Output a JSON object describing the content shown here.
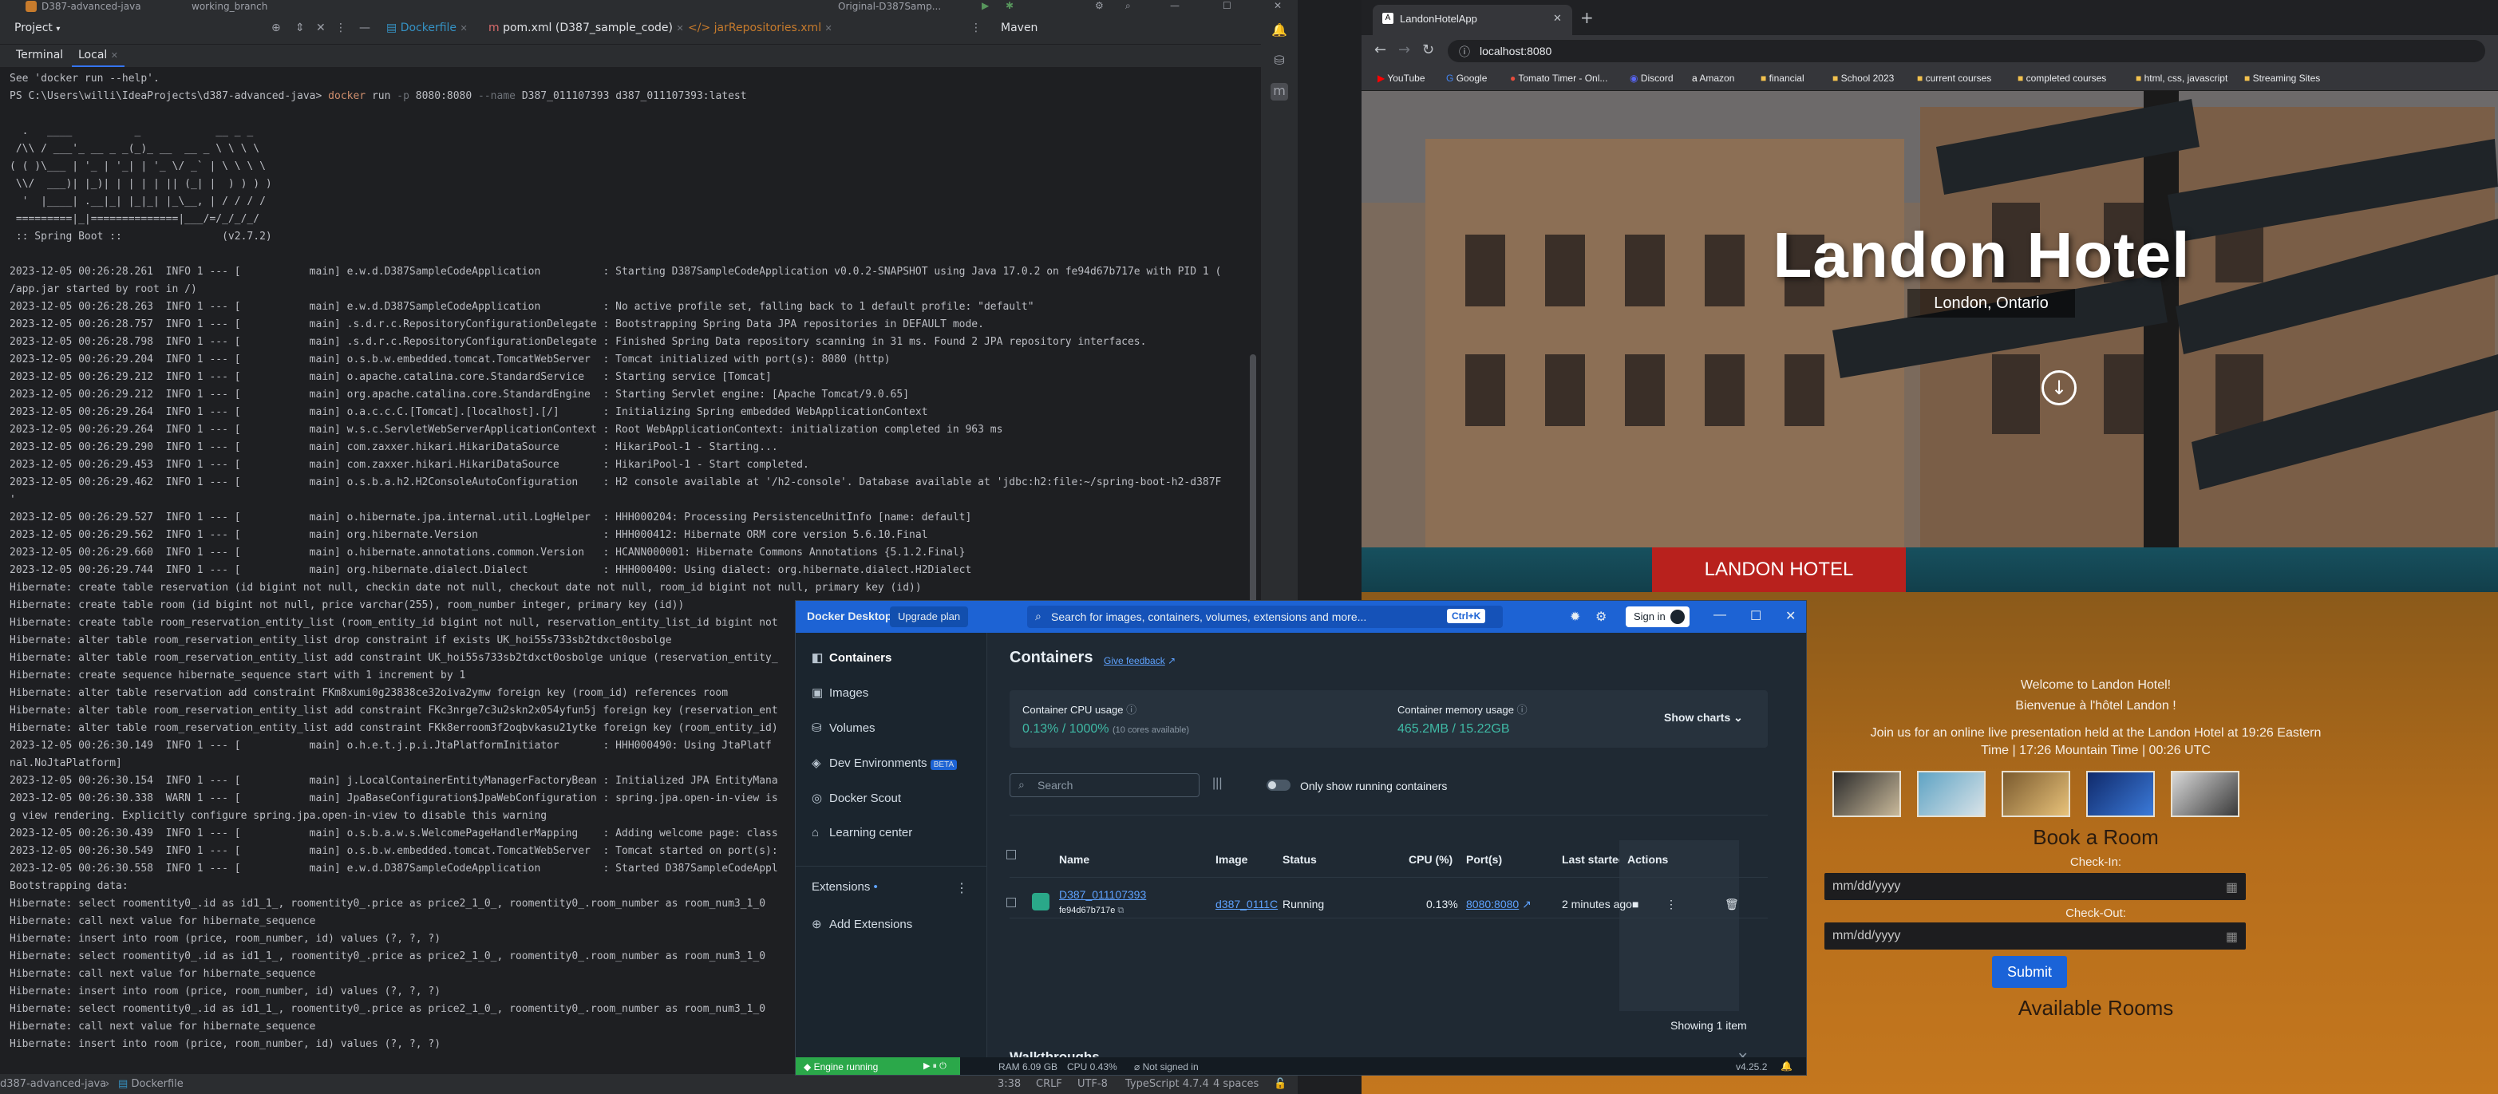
{
  "ide": {
    "topbar": {
      "project_label": "D387-advanced-java",
      "branch_label": "working_branch",
      "run_config": "Original-D387Samp..."
    },
    "toolbar": {
      "project_dropdown": "Project",
      "tabs": [
        {
          "label": "Dockerfile",
          "active": false
        },
        {
          "label": "pom.xml (D387_sample_code)",
          "active": false
        },
        {
          "label": "jarRepositories.xml",
          "active": false
        }
      ],
      "maven_label": "Maven"
    },
    "terminal_tabs": {
      "title": "Terminal",
      "local_tab": "Local"
    },
    "terminal": {
      "prompt_line_prefix": "PS C:\\Users\\willi\\IdeaProjects\\d387-advanced-java> ",
      "command_kw": "docker",
      "command_rest_1": " run ",
      "command_flag_1": "-p",
      "command_rest_2": " 8080:8080 ",
      "command_flag_2": "--name",
      "command_rest_3": " D387_011107393 d387_011107393:latest",
      "pre_line": "See 'docker run --help'.",
      "banner": [
        "",
        "  .   ____          _            __ _ _",
        " /\\\\ / ___'_ __ _ _(_)_ __  __ _ \\ \\ \\ \\",
        "( ( )\\___ | '_ | '_| | '_ \\/ _` | \\ \\ \\ \\",
        " \\\\/  ___)| |_)| | | | | || (_| |  ) ) ) )",
        "  '  |____| .__|_| |_|_| |_\\__, | / / / /",
        " =========|_|==============|___/=/_/_/_/",
        " :: Spring Boot ::                (v2.7.2)",
        ""
      ],
      "log_lines": [
        "2023-12-05 00:26:28.261  INFO 1 --- [           main] e.w.d.D387SampleCodeApplication          : Starting D387SampleCodeApplication v0.0.2-SNAPSHOT using Java 17.0.2 on fe94d67b717e with PID 1 (",
        "/app.jar started by root in /)",
        "2023-12-05 00:26:28.263  INFO 1 --- [           main] e.w.d.D387SampleCodeApplication          : No active profile set, falling back to 1 default profile: \"default\"",
        "2023-12-05 00:26:28.757  INFO 1 --- [           main] .s.d.r.c.RepositoryConfigurationDelegate : Bootstrapping Spring Data JPA repositories in DEFAULT mode.",
        "2023-12-05 00:26:28.798  INFO 1 --- [           main] .s.d.r.c.RepositoryConfigurationDelegate : Finished Spring Data repository scanning in 31 ms. Found 2 JPA repository interfaces.",
        "2023-12-05 00:26:29.204  INFO 1 --- [           main] o.s.b.w.embedded.tomcat.TomcatWebServer  : Tomcat initialized with port(s): 8080 (http)",
        "2023-12-05 00:26:29.212  INFO 1 --- [           main] o.apache.catalina.core.StandardService   : Starting service [Tomcat]",
        "2023-12-05 00:26:29.212  INFO 1 --- [           main] org.apache.catalina.core.StandardEngine  : Starting Servlet engine: [Apache Tomcat/9.0.65]",
        "2023-12-05 00:26:29.264  INFO 1 --- [           main] o.a.c.c.C.[Tomcat].[localhost].[/]       : Initializing Spring embedded WebApplicationContext",
        "2023-12-05 00:26:29.264  INFO 1 --- [           main] w.s.c.ServletWebServerApplicationContext : Root WebApplicationContext: initialization completed in 963 ms",
        "2023-12-05 00:26:29.290  INFO 1 --- [           main] com.zaxxer.hikari.HikariDataSource       : HikariPool-1 - Starting...",
        "2023-12-05 00:26:29.453  INFO 1 --- [           main] com.zaxxer.hikari.HikariDataSource       : HikariPool-1 - Start completed.",
        "2023-12-05 00:26:29.462  INFO 1 --- [           main] o.s.b.a.h2.H2ConsoleAutoConfiguration    : H2 console available at '/h2-console'. Database available at 'jdbc:h2:file:~/spring-boot-h2-d387F",
        "'",
        "2023-12-05 00:26:29.527  INFO 1 --- [           main] o.hibernate.jpa.internal.util.LogHelper  : HHH000204: Processing PersistenceUnitInfo [name: default]",
        "2023-12-05 00:26:29.562  INFO 1 --- [           main] org.hibernate.Version                    : HHH000412: Hibernate ORM core version 5.6.10.Final",
        "2023-12-05 00:26:29.660  INFO 1 --- [           main] o.hibernate.annotations.common.Version   : HCANN000001: Hibernate Commons Annotations {5.1.2.Final}",
        "2023-12-05 00:26:29.744  INFO 1 --- [           main] org.hibernate.dialect.Dialect            : HHH000400: Using dialect: org.hibernate.dialect.H2Dialect",
        "Hibernate: create table reservation (id bigint not null, checkin date not null, checkout date not null, room_id bigint not null, primary key (id))",
        "Hibernate: create table room (id bigint not null, price varchar(255), room_number integer, primary key (id))",
        "Hibernate: create table room_reservation_entity_list (room_entity_id bigint not null, reservation_entity_list_id bigint not",
        "Hibernate: alter table room_reservation_entity_list drop constraint if exists UK_hoi55s733sb2tdxct0osbolge",
        "Hibernate: alter table room_reservation_entity_list add constraint UK_hoi55s733sb2tdxct0osbolge unique (reservation_entity_",
        "Hibernate: create sequence hibernate_sequence start with 1 increment by 1",
        "Hibernate: alter table reservation add constraint FKm8xumi0g23838ce32oiva2ymw foreign key (room_id) references room",
        "Hibernate: alter table room_reservation_entity_list add constraint FKc3nrge7c3u2skn2x054yfun5j foreign key (reservation_ent",
        "Hibernate: alter table room_reservation_entity_list add constraint FKk8erroom3f2oqbvkasu21ytke foreign key (room_entity_id)",
        "2023-12-05 00:26:30.149  INFO 1 --- [           main] o.h.e.t.j.p.i.JtaPlatformInitiator       : HHH000490: Using JtaPlatf",
        "nal.NoJtaPlatform]",
        "2023-12-05 00:26:30.154  INFO 1 --- [           main] j.LocalContainerEntityManagerFactoryBean : Initialized JPA EntityMana",
        "2023-12-05 00:26:30.338  WARN 1 --- [           main] JpaBaseConfiguration$JpaWebConfiguration : spring.jpa.open-in-view is",
        "g view rendering. Explicitly configure spring.jpa.open-in-view to disable this warning",
        "2023-12-05 00:26:30.439  INFO 1 --- [           main] o.s.b.a.w.s.WelcomePageHandlerMapping    : Adding welcome page: class",
        "2023-12-05 00:26:30.549  INFO 1 --- [           main] o.s.b.w.embedded.tomcat.TomcatWebServer  : Tomcat started on port(s):",
        "2023-12-05 00:26:30.558  INFO 1 --- [           main] e.w.d.D387SampleCodeApplication          : Started D387SampleCodeAppl",
        "Bootstrapping data:",
        "Hibernate: select roomentity0_.id as id1_1_, roomentity0_.price as price2_1_0_, roomentity0_.room_number as room_num3_1_0",
        "Hibernate: call next value for hibernate_sequence",
        "Hibernate: insert into room (price, room_number, id) values (?, ?, ?)",
        "Hibernate: select roomentity0_.id as id1_1_, roomentity0_.price as price2_1_0_, roomentity0_.room_number as room_num3_1_0",
        "Hibernate: call next value for hibernate_sequence",
        "Hibernate: insert into room (price, room_number, id) values (?, ?, ?)",
        "Hibernate: select roomentity0_.id as id1_1_, roomentity0_.price as price2_1_0_, roomentity0_.room_number as room_num3_1_0",
        "Hibernate: call next value for hibernate_sequence",
        "Hibernate: insert into room (price, room_number, id) values (?, ?, ?)"
      ]
    },
    "statusbar": {
      "project": "d387-advanced-java",
      "file": "Dockerfile",
      "position": "3:38",
      "line_sep": "CRLF",
      "encoding": "UTF-8",
      "lang": "TypeScript 4.7.4",
      "indent": "4 spaces"
    }
  },
  "browser": {
    "tab_title": "LandonHotelApp",
    "url": "localhost:8080",
    "bookmarks": [
      "YouTube",
      "Google",
      "Tomato Timer - Onl...",
      "Discord",
      "Amazon",
      "financial",
      "School 2023",
      "current courses",
      "completed courses",
      "html, css, javascript",
      "Streaming Sites"
    ],
    "page": {
      "hotel_name": "Landon Hotel",
      "location": "London, Ontario",
      "brand": "LANDON HOTEL",
      "welcome_en": "Welcome to Landon Hotel!",
      "welcome_fr": "Bienvenue à l'hôtel Landon !",
      "presentation_line1": "Join us for an online live presentation held at the Landon Hotel at 19:26 Eastern",
      "presentation_line2": "Time | 17:26 Mountain Time | 00:26 UTC",
      "book_heading": "Book a Room",
      "checkin_label": "Check-In:",
      "checkin_placeholder": "mm/dd/yyyy",
      "checkout_label": "Check-Out:",
      "checkout_placeholder": "mm/dd/yyyy",
      "submit_label": "Submit",
      "rooms_heading": "Available Rooms"
    }
  },
  "docker": {
    "app_title": "Docker Desktop",
    "upgrade_label": "Upgrade plan",
    "search_placeholder": "Search for images, containers, volumes, extensions and more...",
    "search_shortcut": "Ctrl+K",
    "signin_label": "Sign in",
    "nav": [
      {
        "label": "Containers",
        "icon": "containers-icon"
      },
      {
        "label": "Images",
        "icon": "images-icon"
      },
      {
        "label": "Volumes",
        "icon": "volumes-icon"
      },
      {
        "label": "Dev Environments",
        "icon": "dev-env-icon",
        "badge": "BETA"
      },
      {
        "label": "Docker Scout",
        "icon": "scout-icon"
      },
      {
        "label": "Learning center",
        "icon": "learning-icon"
      }
    ],
    "extensions_label": "Extensions",
    "add_extensions_label": "Add Extensions",
    "heading": "Containers",
    "feedback_label": "Give feedback",
    "cpu_title": "Container CPU usage",
    "cpu_value": "0.13% / 1000%",
    "cpu_note": "(10 cores available)",
    "mem_title": "Container memory usage",
    "mem_value": "465.2MB / 15.22GB",
    "show_charts": "Show charts",
    "search_label": "Search",
    "only_running_label": "Only show running containers",
    "columns": [
      "Name",
      "Image",
      "Status",
      "CPU (%)",
      "Port(s)",
      "Last started",
      "Actions"
    ],
    "row": {
      "name": "D387_011107393",
      "id": "fe94d67b717e",
      "image": "d387_0111C",
      "status": "Running",
      "cpu": "0.13%",
      "ports": "8080:8080",
      "last_started": "2 minutes ago"
    },
    "showing": "Showing 1 item",
    "walkthroughs": "Walkthroughs",
    "status": {
      "engine": "Engine running",
      "ram": "RAM 6.09 GB",
      "cpu": "CPU 0.43%",
      "signin": "Not signed in",
      "version": "v4.25.2"
    }
  },
  "colors": {
    "docker_blue": "#1d63d4",
    "hotel_red": "#b8211d",
    "engine_green": "#2ba84a",
    "cpu_teal": "#3fb9a5"
  }
}
